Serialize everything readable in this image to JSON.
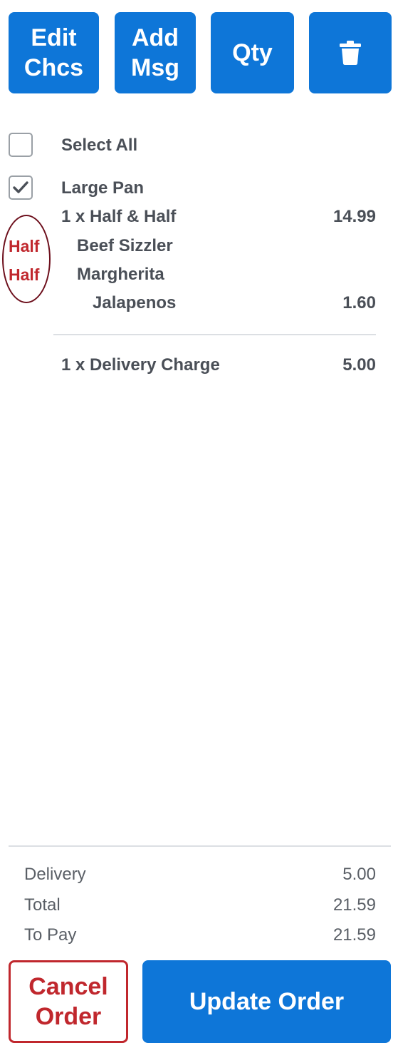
{
  "toolbar": {
    "edit_label": "Edit\nChcs",
    "add_msg_label": "Add\nMsg",
    "qty_label": "Qty",
    "delete_icon": "trash-icon"
  },
  "order": {
    "select_all_label": "Select All",
    "select_all_checked": false,
    "item": {
      "name": "Large Pan",
      "checked": true,
      "line": "1 x Half & Half",
      "price": "14.99",
      "halves": [
        {
          "marker": "Half",
          "topping": "Beef Sizzler"
        },
        {
          "marker": "Half",
          "topping": "Margherita"
        }
      ],
      "extra": {
        "name": "Jalapenos",
        "price": "1.60"
      }
    },
    "delivery_line": {
      "label": "1 x Delivery Charge",
      "price": "5.00"
    }
  },
  "summary": {
    "delivery_label": "Delivery",
    "delivery_value": "5.00",
    "total_label": "Total",
    "total_value": "21.59",
    "topay_label": "To Pay",
    "topay_value": "21.59"
  },
  "actions": {
    "cancel_label": "Cancel\nOrder",
    "update_label": "Update Order"
  },
  "colors": {
    "primary": "#0e76d8",
    "danger": "#c0272d",
    "annotation_ring": "#6d0f1c"
  }
}
